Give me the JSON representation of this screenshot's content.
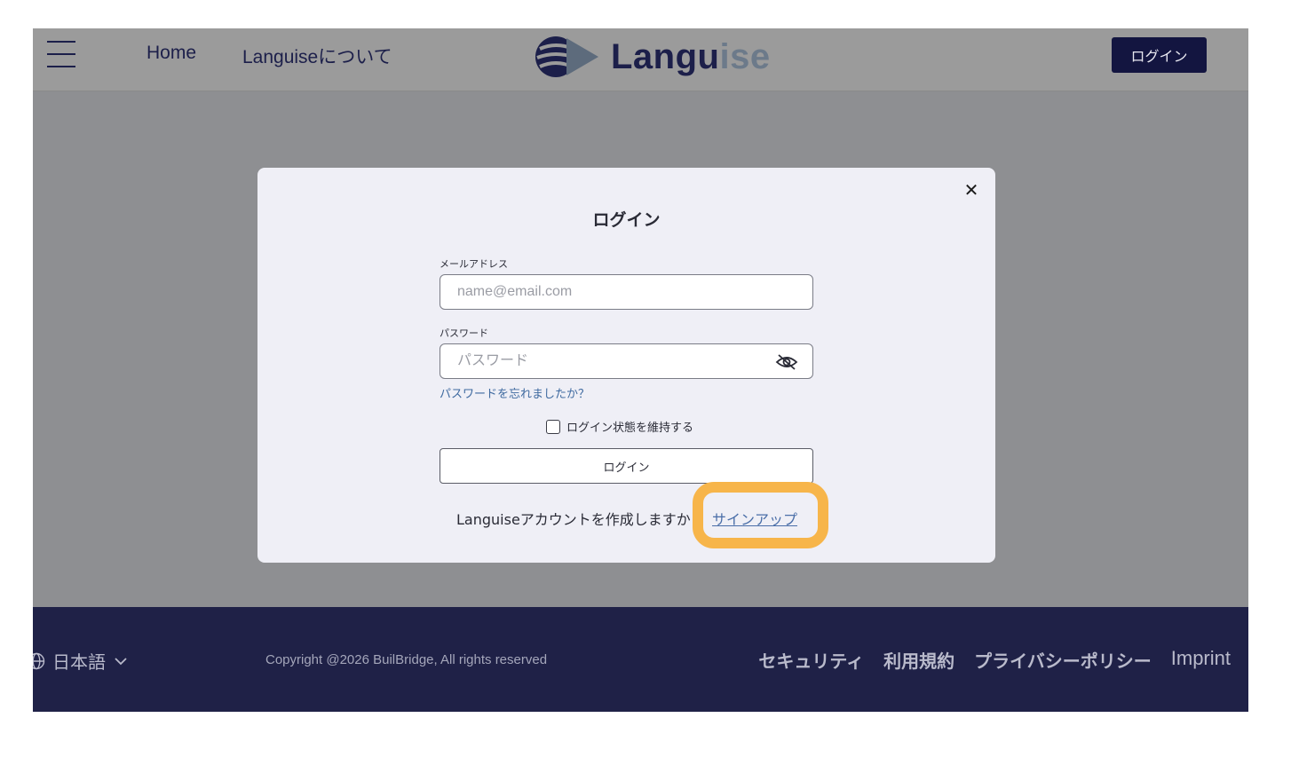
{
  "header": {
    "nav": [
      "Home",
      "Languiseについて"
    ],
    "logo_a": "Langu",
    "logo_b": "ise",
    "login_label": "ログイン"
  },
  "modal": {
    "title": "ログイン",
    "email_label": "メールアドレス",
    "email_placeholder": "name@email.com",
    "password_label": "パスワード",
    "password_placeholder": "パスワード",
    "forgot_label": "パスワードを忘れましたか？",
    "remember_label": "ログイン状態を維持する",
    "login_button": "ログイン",
    "signup_prompt": "Languiseアカウントを作成しますか",
    "signup_link": "サインアップ",
    "highlight_color": "#f7b54a"
  },
  "footer": {
    "language": "日本語",
    "copyright": "Copyright @2026 BuilBridge, All rights reserved",
    "links": [
      "セキュリティ",
      "利用規約",
      "プライバシーポリシー",
      "Imprint"
    ]
  },
  "colors": {
    "brand_navy": "#1c1f4a",
    "footer_bg": "#1f2147",
    "overlay": "#8e8f92",
    "link": "#4a6ea8"
  },
  "icons": [
    "hamburger-icon",
    "logo-icon",
    "close-icon",
    "eye-slash-icon",
    "globe-icon",
    "chevron-down-icon"
  ]
}
